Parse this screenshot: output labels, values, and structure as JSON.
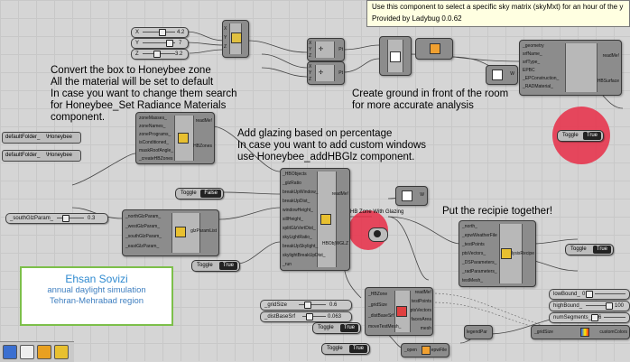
{
  "tooltip": {
    "line1": "Use this component to select a specific sky matrix (skyMxt) for an hour of the y",
    "line2": "Provided by Ladybug 0.0.62"
  },
  "notes": {
    "honeybee_zone": [
      "Convert the box to Honeybee zone",
      "All the material will be set to default",
      "In case you want to change them search",
      "for Honeybee_Set Radiance Materials",
      "component."
    ],
    "glazing": [
      "Add glazing based on percentage",
      "In case you want to add custom windows",
      "use Honeybee_addHBGlz component."
    ],
    "ground": [
      "Create ground in front of the room",
      "for more accurate analysis"
    ],
    "recipe": "Put the recipie together!"
  },
  "credit": {
    "name": "Ehsan Sovizi",
    "line1": "annual daylight simulation",
    "line2": "Tehran-Mehrabad region"
  },
  "sliders": {
    "x": {
      "label": "X",
      "value": "4.2"
    },
    "y": {
      "label": "Y",
      "value": "7"
    },
    "z": {
      "label": "Z",
      "value": "3.2"
    },
    "south_glz": {
      "label": "_southGlzParam_",
      "value": "0.3"
    },
    "grid_size": {
      "label": "_gridSize",
      "value": "0.6"
    },
    "dist_base": {
      "label": "_distBaseSrf",
      "value": "0.063"
    },
    "low_bound": {
      "label": "lowBound_",
      "value": "0"
    },
    "high_bound": {
      "label": "highBound_",
      "value": "100"
    },
    "num_segments": {
      "label": "numSegments_",
      "value": "6"
    }
  },
  "toggles": {
    "t1": {
      "label": "Toggle",
      "value": "True"
    },
    "t2": {
      "label": "Toggle",
      "value": "False"
    },
    "t3": {
      "label": "Toggle",
      "value": "True"
    },
    "t4": {
      "label": "Toggle",
      "value": "True"
    },
    "t5": {
      "label": "Toggle",
      "value": "True"
    },
    "t6": {
      "label": "Toggle",
      "value": "True"
    },
    "t7": {
      "label": "Toggle",
      "value": "True"
    }
  },
  "folder_params": {
    "a": "defaultFolder_",
    "b": "defaultFolder_",
    "va": "\\Honeybee",
    "vb": "\\Honeybee"
  },
  "masses2zones": {
    "in": [
      "zoneMasses_",
      "zoneNames_",
      "zonePrograms_",
      "isConditioned_",
      "maskRoofAngle_",
      "_createHBZones"
    ],
    "out": [
      "readMe!",
      "HBZones"
    ]
  },
  "glz_by_ratio": {
    "in": [
      "_HBObjects",
      "_glzRatio",
      "breakUpWindow_",
      "breakUpDist_",
      "windowHeight_",
      "sillHeight_",
      "splitGlzVertDist_",
      "skyLightRatio_",
      "breakUpSkylight_",
      "skylightBreakUpDist_",
      "_run"
    ],
    "out": [
      "readMe!",
      "HBObjWGLZ"
    ]
  },
  "glz_params": {
    "in": [
      "_northGlzParam_",
      "_westGlzParam_",
      "_southGlzParam_",
      "_eastGlzParam_"
    ],
    "out": [
      "glzParamList"
    ]
  },
  "hb_label": "HB Zone With Glazing",
  "geo_comp": {
    "in": [
      "_geometry",
      "srfName_",
      "srfType_",
      "EPBC",
      "_EPConstruction_",
      "_RADMaterial_"
    ],
    "out": [
      "readMe!",
      "HBSurface"
    ]
  },
  "recipe_comp": {
    "in": [
      "_north_",
      "_epwWeatherFile",
      "_testPoints",
      "ptsVectors_",
      "_DSParameters_",
      "_radParameters_",
      "testMesh_"
    ],
    "out": [
      "analysisRecipe"
    ]
  },
  "test_points": {
    "in": [
      "_HBZone",
      "_gridSize",
      "_distBaseSrf",
      "moveTestMesh_"
    ],
    "out": [
      "readMe!",
      "testPoints",
      "ptsVectors",
      "facesArea",
      "mesh"
    ]
  },
  "misc": {
    "x_in": "X",
    "y_in": "Y",
    "z_in": "Z",
    "pt_out": "Pt",
    "w_in": "W",
    "legend_label": "legendPar",
    "custom_colors": "customColors",
    "open_label": "_open",
    "epw_label": "epwFile",
    "grid_label": "_gridSize",
    "dist_label": "_distBaseSrf",
    "toggle_on": "True"
  },
  "colors": {
    "red_marker": "#e82d46",
    "credit_border": "#7cbf4a",
    "credit_text": "#2f8ad0"
  }
}
